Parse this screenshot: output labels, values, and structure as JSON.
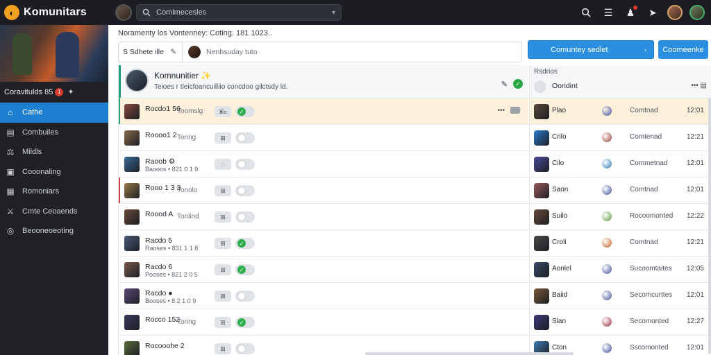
{
  "app": {
    "name": "Komunitars",
    "logo_glyph": "◐"
  },
  "search": {
    "text": "Comlmecesles"
  },
  "sidebar": {
    "community_label": "Coravitulds 85",
    "community_badge": "1",
    "items": [
      {
        "label": "Cathe",
        "icon": "⌂",
        "icon_name": "home-icon",
        "active": true
      },
      {
        "label": "Combuiles",
        "icon": "▤",
        "icon_name": "card-icon",
        "active": false
      },
      {
        "label": "Mildls",
        "icon": "⚖",
        "icon_name": "members-icon",
        "active": false
      },
      {
        "label": "Cooonaling",
        "icon": "▣",
        "icon_name": "calendar-icon",
        "active": false
      },
      {
        "label": "Romoniars",
        "icon": "▦",
        "icon_name": "list-icon",
        "active": false
      },
      {
        "label": "Cmte Ceoaends",
        "icon": "⚔",
        "icon_name": "events-icon",
        "active": false
      },
      {
        "label": "Beooneoeoting",
        "icon": "◎",
        "icon_name": "settings-icon",
        "active": false
      }
    ]
  },
  "main": {
    "breadcrumb": "Noramenty los Vontenney: Coting. 181 1023..",
    "compose_tab": "S Sdhete ille",
    "compose_placeholder": "Nenbsuday tuto",
    "primary_button": "Comuntey sedlet",
    "primary_arrow": "›",
    "secondary_button": "Coomeenke",
    "group": {
      "title": "Komnunitier ✨",
      "subtitle": "Teioes r tleicfoancuilliio concdoo gilctsdy ld.",
      "check": "✓",
      "icon": "✎"
    },
    "rows": [
      {
        "name": "Rocdo1 56",
        "meta": "",
        "status": "Toomslg",
        "pill": "▣ⲟ",
        "toggle_on": true,
        "highlight": true,
        "actions": "•••",
        "avatar": "#8a4a3c",
        "accent": "#1fa27a"
      },
      {
        "name": "Roooo1 2",
        "meta": "",
        "status": "Toring",
        "pill": "⊞",
        "toggle_on": false,
        "highlight": false,
        "actions": "",
        "avatar": "#8a6a4a",
        "accent": ""
      },
      {
        "name": "Raoob ⚙",
        "meta": "Baooos • 821 0 1 9",
        "status": "",
        "pill": "◌",
        "toggle_on": false,
        "highlight": false,
        "actions": "",
        "avatar": "#3a6a9a",
        "accent": ""
      },
      {
        "name": "Rooo 1 3 3",
        "meta": "",
        "status": "Tonolo",
        "pill": "⊞",
        "toggle_on": false,
        "highlight": false,
        "actions": "",
        "avatar": "#9a7a4a",
        "accent": "#d04040"
      },
      {
        "name": "Roood A",
        "meta": "",
        "status": "Tonlind",
        "pill": "⊞",
        "toggle_on": false,
        "highlight": false,
        "actions": "",
        "avatar": "#6a4a3a",
        "accent": ""
      },
      {
        "name": "Racdo 5",
        "meta": "Raoses • 831 1 1 8",
        "status": "",
        "pill": "⊞",
        "toggle_on": true,
        "highlight": false,
        "actions": "",
        "avatar": "#4a5a7a",
        "accent": ""
      },
      {
        "name": "Racdo 6",
        "meta": "Pooses • 821 2 0 5",
        "status": "",
        "pill": "⊞",
        "toggle_on": true,
        "highlight": false,
        "actions": "",
        "avatar": "#7a5a4a",
        "accent": ""
      },
      {
        "name": "Racdo ●",
        "meta": "Booses • 8 2 1 0 9",
        "status": "",
        "pill": "⊞",
        "toggle_on": false,
        "highlight": false,
        "actions": "",
        "avatar": "#5a4a7a",
        "accent": ""
      },
      {
        "name": "Rocco 152",
        "meta": "",
        "status": "Toring",
        "pill": "⊞",
        "toggle_on": true,
        "highlight": false,
        "actions": "",
        "avatar": "#3a3a5a",
        "accent": ""
      },
      {
        "name": "Rocooohe 2",
        "meta": "",
        "status": "",
        "pill": "⊞",
        "toggle_on": false,
        "highlight": false,
        "actions": "",
        "avatar": "#5a6a3a",
        "accent": ""
      }
    ]
  },
  "right": {
    "label": "Rsdrios",
    "title": "Ooridint",
    "dots": "••• ▤",
    "rows": [
      {
        "name": "Plao",
        "status": "Comtnad",
        "time": "12:01",
        "avatar": "#5a4a3a",
        "dot": "#3a4a9a",
        "highlight": true
      },
      {
        "name": "Crilo",
        "status": "Comtenad",
        "time": "12:21",
        "avatar": "#2a7ad0",
        "dot": "#9a3a2a",
        "highlight": false
      },
      {
        "name": "Cilo",
        "status": "Commetnad",
        "time": "12:01",
        "avatar": "#4a4a9a",
        "dot": "#2a7ab0",
        "highlight": false
      },
      {
        "name": "Saon",
        "status": "Comtnad",
        "time": "12:01",
        "avatar": "#9a5a5a",
        "dot": "#3a4a9a",
        "highlight": false
      },
      {
        "name": "Suilo",
        "status": "Rocoomonted",
        "time": "12:22",
        "avatar": "#6a4a3a",
        "dot": "#5a9a3a",
        "highlight": false
      },
      {
        "name": "Croli",
        "status": "Comtnad",
        "time": "12:21",
        "avatar": "#4a4a4a",
        "dot": "#c05a1a",
        "highlight": false
      },
      {
        "name": "Aonlel",
        "status": "Sucoomtaites",
        "time": "12:05",
        "avatar": "#3a4a6a",
        "dot": "#3a4a9a",
        "highlight": false
      },
      {
        "name": "Baiid",
        "status": "Secomcurttes",
        "time": "12:01",
        "avatar": "#7a5a3a",
        "dot": "#3a4a9a",
        "highlight": false
      },
      {
        "name": "Slan",
        "status": "Secomonted",
        "time": "12:27",
        "avatar": "#3a3a7a",
        "dot": "#9a2a3a",
        "highlight": false
      },
      {
        "name": "Cton",
        "status": "Sscomonted",
        "time": "12:01",
        "avatar": "#3a7ab0",
        "dot": "#3a4a9a",
        "highlight": false
      }
    ]
  },
  "colors": {
    "accent": "#2a8fe0",
    "sidebar_bg": "#1f2126",
    "topbar_bg": "#1b1d22",
    "highlight_row": "#fdf1dc",
    "success": "#2fae4e"
  }
}
